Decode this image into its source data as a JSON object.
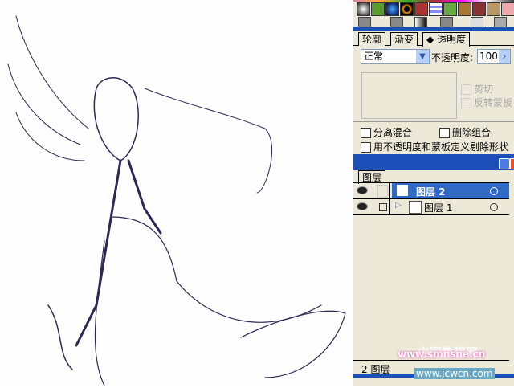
{
  "transparency_panel": {
    "tabs": [
      "轮廓",
      "渐变",
      "透明度"
    ],
    "blend_mode": "正常",
    "opacity_label": "不透明度:",
    "opacity_value": "100",
    "clip_label": "剪切",
    "invert_mask_label": "反转蒙板",
    "isolate_blending_label": "分离混合",
    "knockout_group_label": "删除组合",
    "opacity_mask_knockout_label": "用不透明度和蒙板定义剔除形状"
  },
  "layers_panel": {
    "tab": "图层",
    "layers": [
      {
        "name": "图层 2",
        "selected": true
      },
      {
        "name": "图层 1",
        "selected": false
      }
    ],
    "footer": "2 图层"
  },
  "watermark": {
    "text1": "www.smnsne.cn",
    "text2": "www.jcwcn.com",
    "text3": "中国教程网"
  },
  "colors": {
    "title_bar": "#1c4fb8",
    "panel_bg": "#ece9d8",
    "selection": "#3169c6"
  }
}
